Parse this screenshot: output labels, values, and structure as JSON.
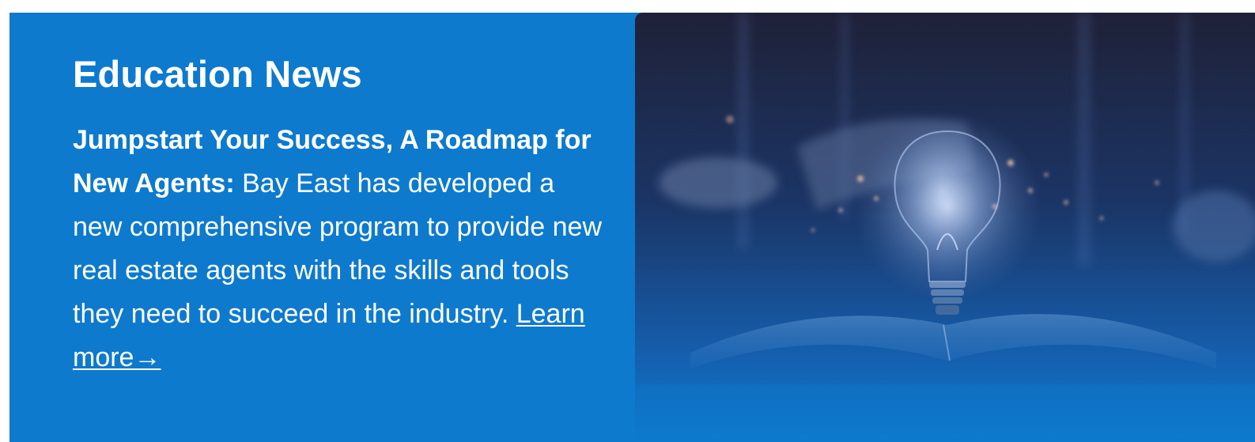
{
  "section": {
    "heading": "Education News",
    "article": {
      "lead": "Jumpstart Your Success, A Roadmap for New Agents:",
      "body": " Bay East has developed a new comprehensive program to provide new real estate agents with the skills and tools they need to succeed in the industry. ",
      "link_text": "Learn more→"
    },
    "image": {
      "subject": "hand-lightbulb-open-book-photo"
    }
  },
  "colors": {
    "banner_bg": "#0d7ace",
    "photo_dark": "#1f2138",
    "text": "#ffffff"
  }
}
